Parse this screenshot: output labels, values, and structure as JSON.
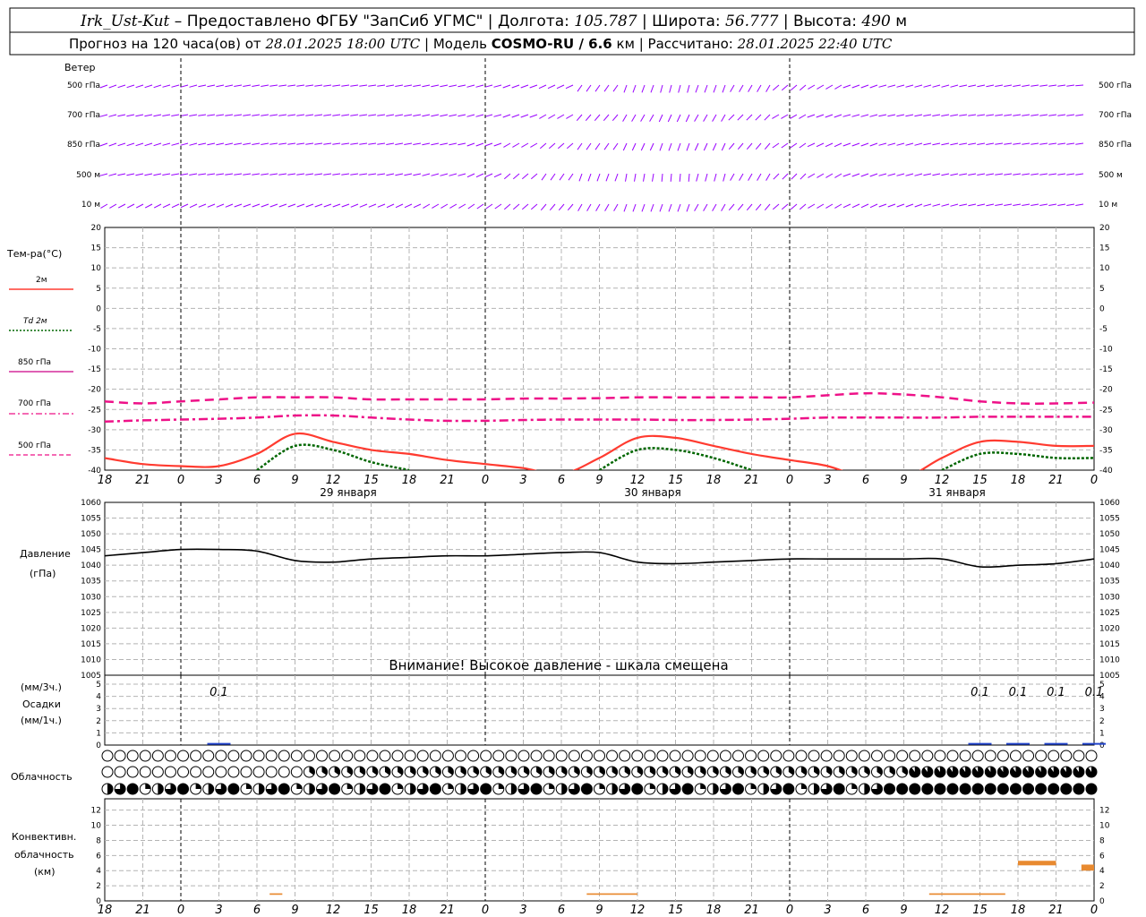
{
  "header": {
    "station": "Irk_Ust-Kut",
    "provider": "Предоставлено ФГБУ \"ЗапСиб УГМС\"",
    "lon_label": "Долгота:",
    "lon_value": "105.787",
    "lat_label": "Широта:",
    "lat_value": "56.777",
    "alt_label": "Высота:",
    "alt_value": "490",
    "alt_unit": "м",
    "forecast_text": "Прогноз на 120 часа(ов) от",
    "forecast_start": "28.01.2025 18:00 UTC",
    "model_label": "Модель",
    "model_name": "COSMO-RU / 6.6",
    "model_unit": "км",
    "calc_label": "Рассчитано:",
    "calc_time": "28.01.2025 22:40 UTC"
  },
  "wind": {
    "title": "Ветер",
    "levels": [
      "500 гПа",
      "700 гПа",
      "850 гПа",
      "500 м",
      "10 м"
    ],
    "color": "#9900ff"
  },
  "temperature": {
    "title": "Тем-ра(°C)",
    "legend": [
      {
        "label": "2м",
        "color": "#ff3b30",
        "style": "solid"
      },
      {
        "label": "Td  2м",
        "color": "#006600",
        "style": "dotted"
      },
      {
        "label": "850 гПа",
        "color": "#cc0088",
        "style": "solid"
      },
      {
        "label": "700 гПа",
        "color": "#ee1188",
        "style": "dashdot"
      },
      {
        "label": "500 гПа",
        "color": "#ee1188",
        "style": "dashed"
      }
    ]
  },
  "pressure": {
    "title": "Давление",
    "unit": "(гПа)",
    "warning": "Внимание! Высокое давление - шкала смещена"
  },
  "precip": {
    "unit_top": "(мм/3ч.)",
    "title": "Осадки",
    "unit_bottom": "(мм/1ч.)",
    "labels": [
      "0.1",
      "0.1",
      "0.1",
      "0.1",
      "0.1"
    ]
  },
  "clouds": {
    "title": "Облачность"
  },
  "convective": {
    "title_1": "Конвективн.",
    "title_2": "облачность",
    "unit": "(км)"
  },
  "x_axis": {
    "hour_labels": [
      "18",
      "21",
      "0",
      "3",
      "6",
      "9",
      "12",
      "15",
      "18",
      "21",
      "0",
      "3",
      "6",
      "9",
      "12",
      "15",
      "18",
      "21",
      "0",
      "3",
      "6",
      "9",
      "12",
      "15",
      "18",
      "21",
      "0"
    ],
    "days": [
      "29 января",
      "30 января",
      "31 января"
    ]
  },
  "chart_data": [
    {
      "type": "line",
      "title": "Тем-ра(°C)",
      "x_hours": [
        0,
        3,
        6,
        9,
        12,
        15,
        18,
        21,
        24,
        27,
        30,
        33,
        36,
        39,
        42,
        45,
        48,
        51,
        54,
        57,
        60,
        63,
        66,
        69,
        72,
        75,
        78
      ],
      "ylim": [
        -40,
        20
      ],
      "yticks": [
        -40,
        -35,
        -30,
        -25,
        -20,
        -15,
        -10,
        -5,
        0,
        5,
        10,
        15,
        20
      ],
      "series": [
        {
          "name": "2м",
          "values": [
            -37,
            -38.5,
            -39,
            -39,
            -36,
            -31,
            -33,
            -35,
            -36,
            -37.5,
            -38.5,
            -39.5,
            -41,
            -37,
            -32,
            -32,
            -34,
            -36,
            -37.5,
            -39,
            -42,
            -42,
            -37,
            -33,
            -33,
            -34,
            -34
          ]
        },
        {
          "name": "Td  2м",
          "values": [
            null,
            null,
            null,
            null,
            -40,
            -34,
            -35,
            -38,
            -40,
            null,
            null,
            null,
            null,
            -40,
            -35,
            -35,
            -37,
            -40,
            null,
            null,
            null,
            null,
            -40,
            -36,
            -36,
            -37,
            -37
          ]
        },
        {
          "name": "700 гПа",
          "values": [
            -28,
            -27.7,
            -27.5,
            -27.3,
            -27,
            -26.5,
            -26.5,
            -27,
            -27.5,
            -27.8,
            -27.8,
            -27.6,
            -27.5,
            -27.5,
            -27.5,
            -27.6,
            -27.6,
            -27.5,
            -27.3,
            -27,
            -27,
            -27,
            -27,
            -26.8,
            -26.8,
            -26.8,
            -26.8
          ]
        },
        {
          "name": "500 гПа",
          "values": [
            -23,
            -23.5,
            -23,
            -22.5,
            -22,
            -22,
            -22,
            -22.5,
            -22.5,
            -22.5,
            -22.5,
            -22.3,
            -22.3,
            -22.2,
            -22,
            -22,
            -22,
            -22,
            -22,
            -21.5,
            -21,
            -21.3,
            -22,
            -23,
            -23.5,
            -23.5,
            -23.3
          ]
        }
      ]
    },
    {
      "type": "line",
      "title": "Давление (гПа)",
      "ylim": [
        1005,
        1060
      ],
      "yticks": [
        1005,
        1010,
        1015,
        1020,
        1025,
        1030,
        1035,
        1040,
        1045,
        1050,
        1055,
        1060
      ],
      "x_hours": [
        0,
        3,
        6,
        9,
        12,
        15,
        18,
        21,
        24,
        27,
        30,
        33,
        36,
        39,
        42,
        45,
        48,
        51,
        54,
        57,
        60,
        63,
        66,
        69,
        72,
        75,
        78
      ],
      "series": [
        {
          "name": "Давление",
          "values": [
            1043,
            1044,
            1045,
            1045,
            1044.5,
            1041.5,
            1041,
            1042,
            1042.5,
            1043,
            1043,
            1043.5,
            1044,
            1044,
            1041,
            1040.5,
            1041,
            1041.5,
            1042,
            1042,
            1042,
            1042,
            1042,
            1039.5,
            1040,
            1040.5,
            1042
          ]
        }
      ]
    },
    {
      "type": "bar",
      "title": "Осадки (мм/3ч.)",
      "ylim": [
        0,
        5
      ],
      "yticks": [
        0,
        1,
        2,
        3,
        4,
        5
      ],
      "x_hours": [
        9,
        69,
        72,
        75,
        78
      ],
      "values": [
        0.1,
        0.1,
        0.1,
        0.1,
        0.1
      ]
    },
    {
      "type": "bar",
      "title": "Конвективн. облачность (км)",
      "ylim": [
        0,
        12
      ],
      "yticks": [
        0,
        2,
        4,
        6,
        8,
        10,
        12
      ],
      "segments": [
        {
          "x_start": 13,
          "x_end": 14,
          "bottom": 0.8,
          "top": 1.0
        },
        {
          "x_start": 38,
          "x_end": 42,
          "bottom": 0.8,
          "top": 1.0
        },
        {
          "x_start": 65,
          "x_end": 71,
          "bottom": 0.8,
          "top": 1.0
        },
        {
          "x_start": 72,
          "x_end": 75,
          "bottom": 4.7,
          "top": 5.3
        },
        {
          "x_start": 77,
          "x_end": 78,
          "bottom": 4.0,
          "top": 4.8
        }
      ]
    }
  ]
}
